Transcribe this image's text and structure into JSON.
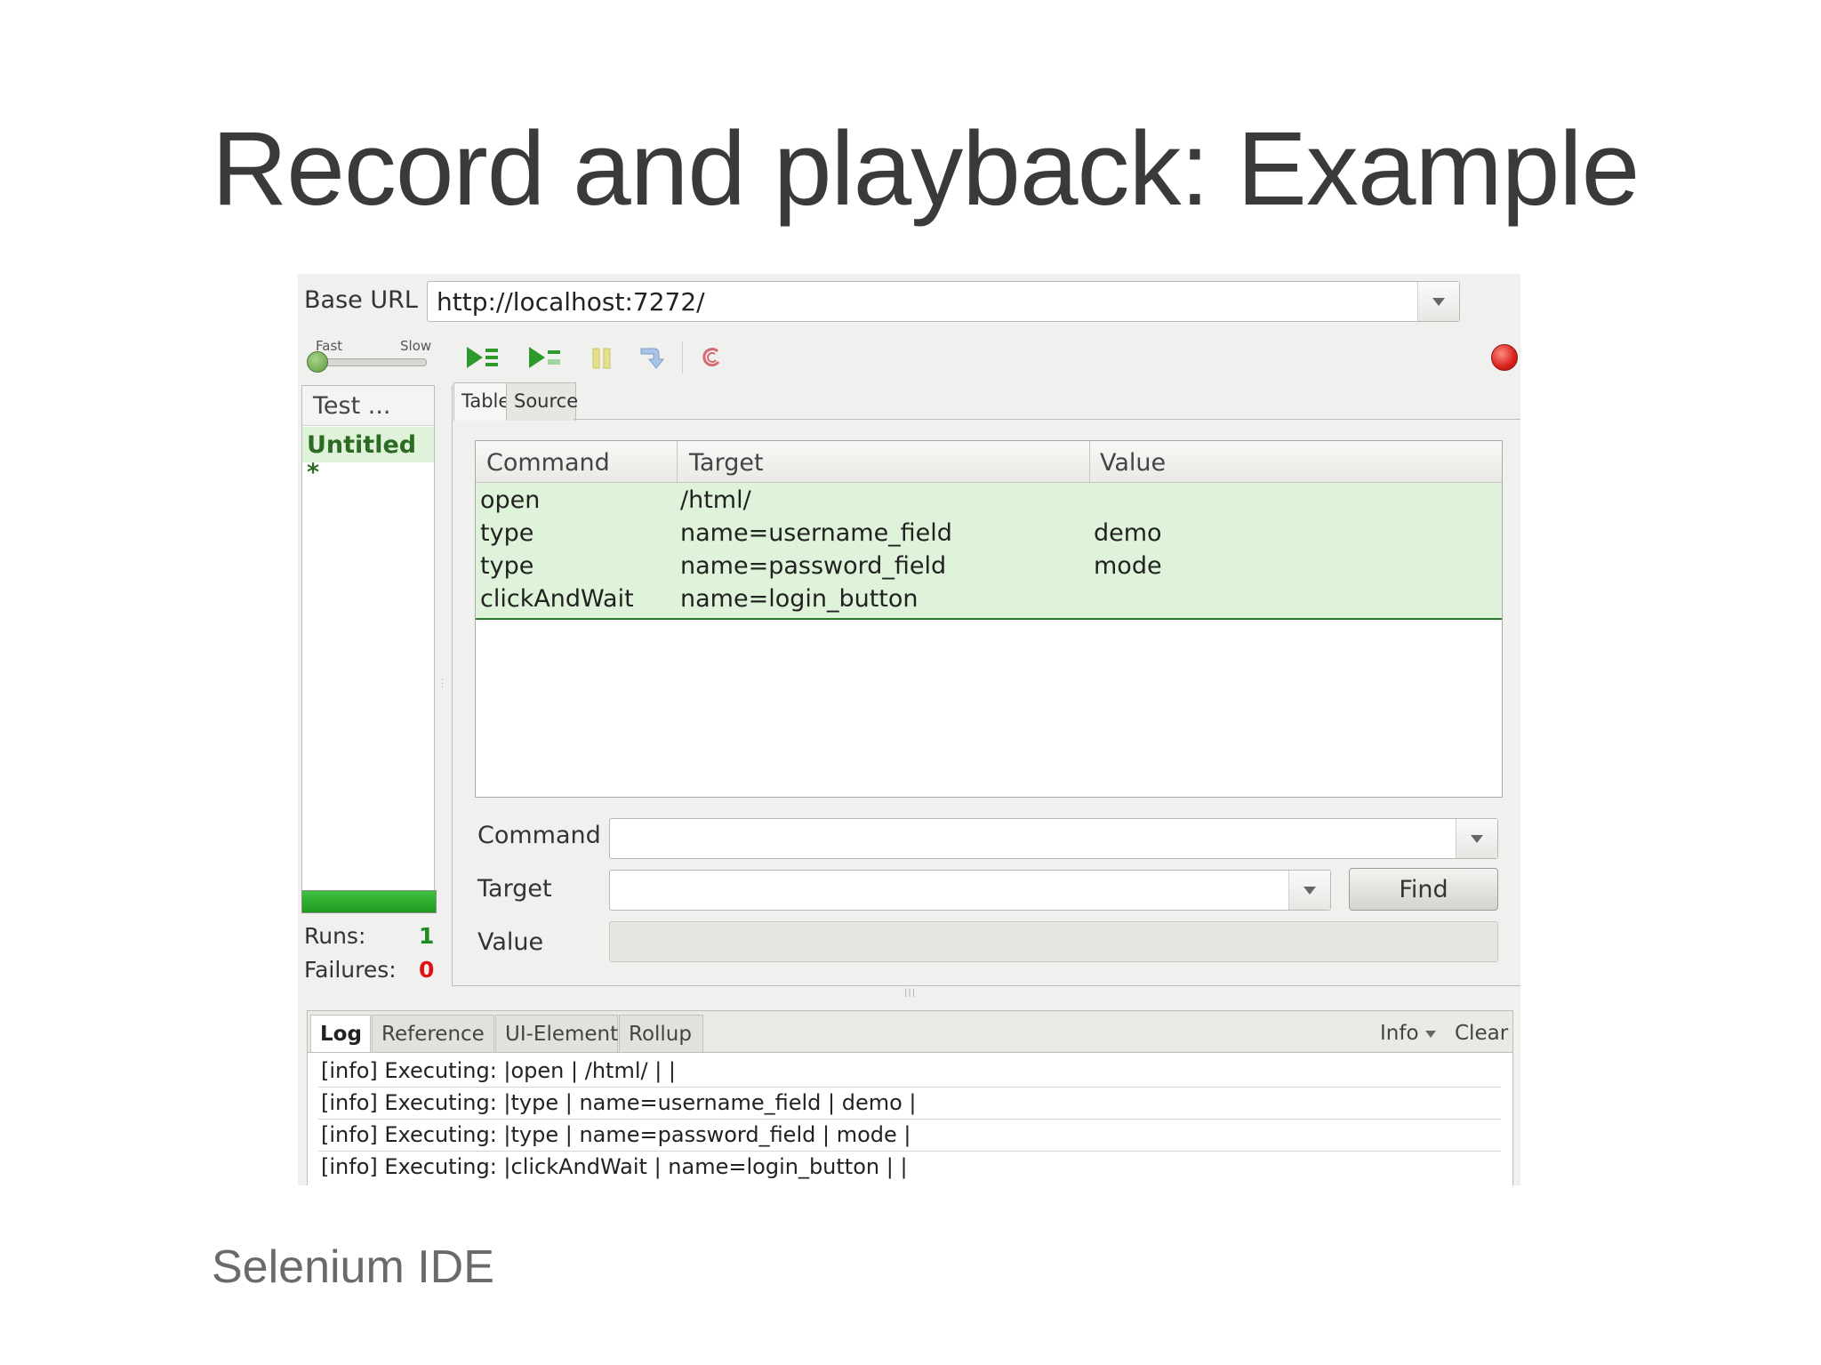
{
  "slide": {
    "title": "Record and playback: Example",
    "footer": "Selenium IDE"
  },
  "ide": {
    "base_url_label": "Base URL",
    "base_url_value": "http://localhost:7272/",
    "speed": {
      "fast_label": "Fast",
      "slow_label": "Slow",
      "level": 0.0
    },
    "toolbar": {
      "icons": [
        "play-suite-icon",
        "play-test-icon",
        "pause-icon",
        "step-icon",
        "rollup-icon",
        "record-icon"
      ],
      "accent_green": "#2e9a2e",
      "record_red": "#d8201a"
    },
    "suite": {
      "header": "Test ...",
      "items": [
        {
          "label": "Untitled *"
        }
      ]
    },
    "stats": {
      "runs_label": "Runs:",
      "runs_value": "1",
      "failures_label": "Failures:",
      "failures_value": "0",
      "progress": 1.0
    },
    "editor_tabs": [
      {
        "label": "Table",
        "active": true
      },
      {
        "label": "Source",
        "active": false
      }
    ],
    "table": {
      "columns": [
        "Command",
        "Target",
        "Value"
      ],
      "rows": [
        {
          "command": "open",
          "target": "/html/",
          "value": ""
        },
        {
          "command": "type",
          "target": "name=username_field",
          "value": "demo"
        },
        {
          "command": "type",
          "target": "name=password_field",
          "value": "mode"
        },
        {
          "command": "clickAndWait",
          "target": "name=login_button",
          "value": ""
        }
      ],
      "executed_row_color": "#def3d9"
    },
    "form": {
      "command_label": "Command",
      "command_value": "",
      "target_label": "Target",
      "target_value": "",
      "find_label": "Find",
      "value_label": "Value",
      "value_value": ""
    },
    "log": {
      "tabs": [
        "Log",
        "Reference",
        "UI-Element",
        "Rollup"
      ],
      "active_tab": "Log",
      "level_label": "Info",
      "clear_label": "Clear",
      "lines": [
        "[info] Executing: |open | /html/ | |",
        "[info] Executing: |type | name=username_field | demo |",
        "[info] Executing: |type | name=password_field | mode |",
        "[info] Executing: |clickAndWait | name=login_button | |"
      ]
    }
  }
}
